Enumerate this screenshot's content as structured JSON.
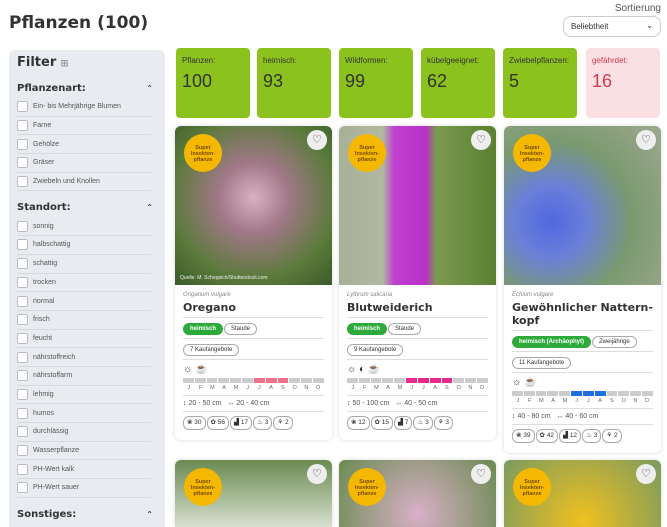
{
  "header": {
    "title": "Pflanzen (100)",
    "sort_label": "Sortierung",
    "sort_value": "Beliebtheit"
  },
  "sidebar": {
    "title": "Filter",
    "sections": [
      {
        "label": "Pflanzenart:",
        "options": [
          "Ein- bis Mehrjährige Blumen",
          "Farne",
          "Gehölze",
          "Gräser",
          "Zwiebeln und Knollen"
        ]
      },
      {
        "label": "Standort:",
        "options": [
          "sonnig",
          "halbschattig",
          "schattig",
          "trocken",
          "normal",
          "frisch",
          "feucht",
          "nährstoffreich",
          "nährstoffarm",
          "lehmig",
          "humos",
          "durchlässig",
          "Wasserpflanze",
          "PH-Wert kalk",
          "PH-Wert sauer"
        ]
      },
      {
        "label": "Sonstiges:",
        "options": []
      }
    ]
  },
  "stats": [
    {
      "label": "Pflanzen:",
      "value": "100"
    },
    {
      "label": "heimisch:",
      "value": "93"
    },
    {
      "label": "Wildformen:",
      "value": "99"
    },
    {
      "label": "kübelgeeignet:",
      "value": "62"
    },
    {
      "label": "Zwiebelpflanzen:",
      "value": "5"
    },
    {
      "label": "gefährdet:",
      "value": "16"
    }
  ],
  "months": [
    "J",
    "F",
    "M",
    "A",
    "M",
    "J",
    "J",
    "A",
    "S",
    "O",
    "N",
    "D"
  ],
  "badge": "Super Insekten-pflanze",
  "cards": [
    {
      "species": "Origanum vulgare",
      "name": "Oregano",
      "tags": [
        "heimisch",
        "Staude"
      ],
      "offers": "7 Kaufangebote",
      "icons": "☼ ☕",
      "bloom": [
        7,
        8,
        9
      ],
      "color": "#f07088",
      "height": "20 - 50 cm",
      "width": "20 - 40 cm",
      "counts": [
        "30",
        "56",
        "17",
        "3",
        "2"
      ],
      "credit": "Quelle: M. Schoppich/Shutterstock.com"
    },
    {
      "species": "Lythrum salicaria",
      "name": "Blutweiderich",
      "tags": [
        "heimisch",
        "Staude"
      ],
      "offers": "9 Kaufangebote",
      "icons": "☼ ◐ ☕",
      "bloom": [
        6,
        7,
        8,
        9
      ],
      "color": "#e8288a",
      "height": "50 - 100 cm",
      "width": "40 - 50 cm",
      "counts": [
        "12",
        "15",
        "7",
        "3",
        "3"
      ]
    },
    {
      "species": "Echium vulgare",
      "name": "Gewöhnlicher Nattern-kopf",
      "tags": [
        "heimisch (Archäophyt)",
        "Zweijährige"
      ],
      "offers": "11 Kaufangebote",
      "icons": "☼ ☕",
      "bloom": [
        6,
        7,
        8
      ],
      "color": "#1e6fe0",
      "height": "40 - 80 cm",
      "width": "40 - 60 cm",
      "counts": [
        "39",
        "42",
        "12",
        "3",
        "2"
      ]
    }
  ]
}
